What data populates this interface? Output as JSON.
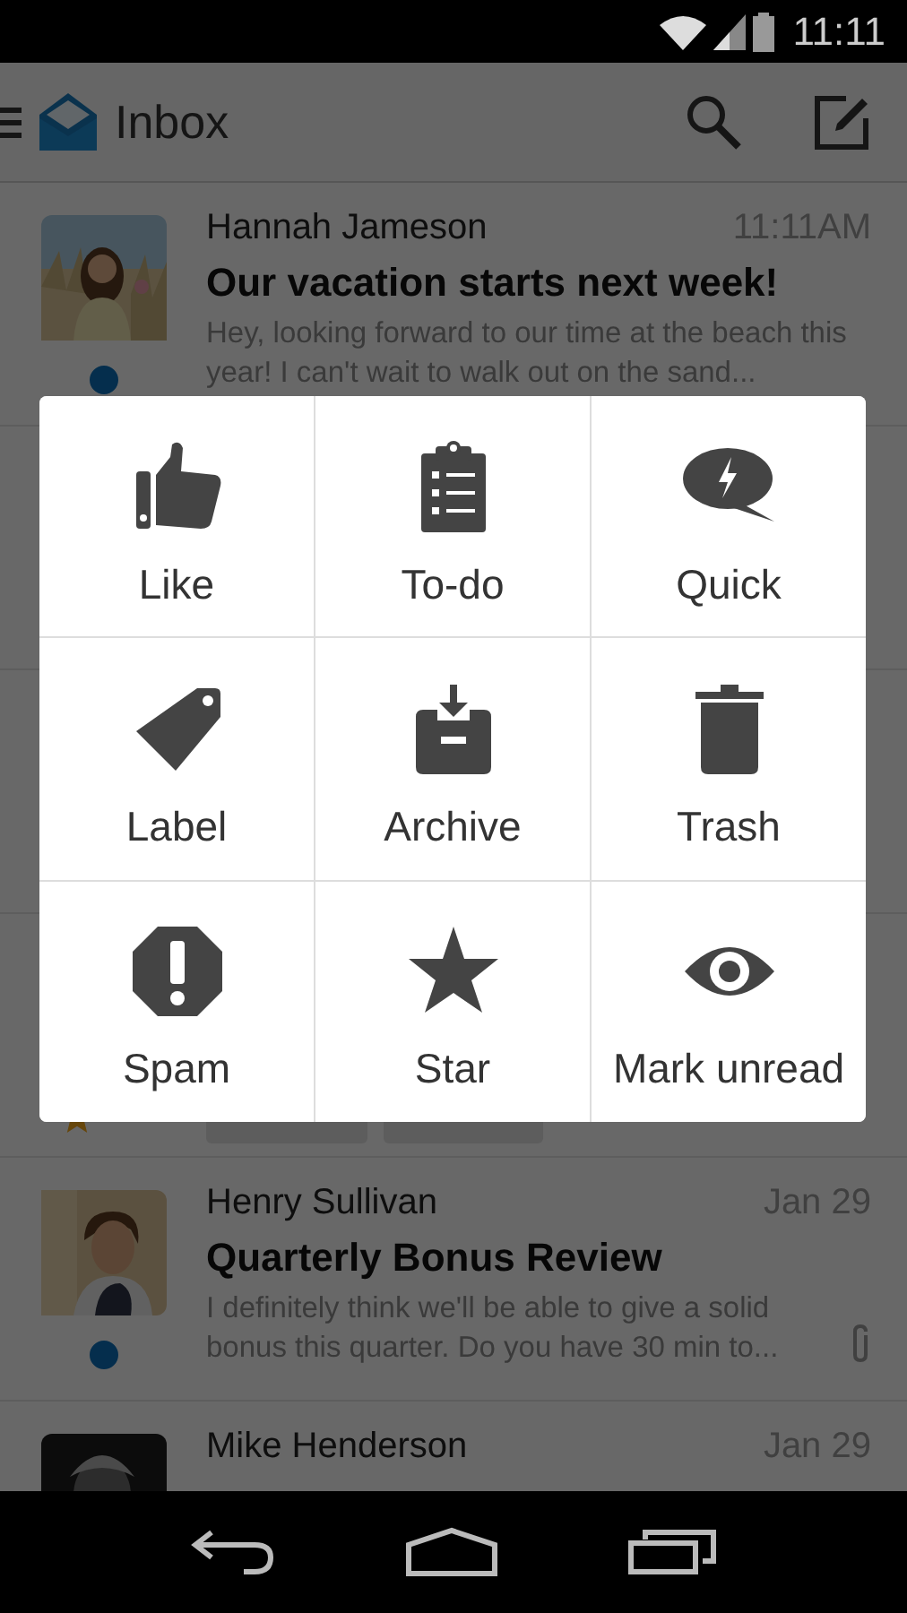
{
  "status_bar": {
    "time": "11:11"
  },
  "app_bar": {
    "title": "Inbox"
  },
  "emails": [
    {
      "kind": "message",
      "sender": "Hannah Jameson",
      "time": "11:11AM",
      "subject": "Our vacation starts next week!",
      "preview": "Hey, looking forward to our time at the beach this year! I can't wait to walk out on the sand...",
      "unread": true,
      "attachment": false
    },
    {
      "kind": "covered"
    },
    {
      "kind": "covered"
    },
    {
      "kind": "covered",
      "starred": true
    },
    {
      "kind": "message",
      "sender": "Henry Sullivan",
      "time": "Jan 29",
      "subject": "Quarterly Bonus Review",
      "preview": "I definitely think we'll be able to give a solid bonus this quarter. Do you have 30 min to...",
      "unread": true,
      "attachment": true
    },
    {
      "kind": "message",
      "sender": "Mike Henderson",
      "time": "Jan 29"
    }
  ],
  "actions": [
    {
      "kind": "like",
      "label": "Like"
    },
    {
      "kind": "todo",
      "label": "To-do"
    },
    {
      "kind": "quick",
      "label": "Quick"
    },
    {
      "kind": "label",
      "label": "Label"
    },
    {
      "kind": "archive",
      "label": "Archive"
    },
    {
      "kind": "trash",
      "label": "Trash"
    },
    {
      "kind": "spam",
      "label": "Spam"
    },
    {
      "kind": "star",
      "label": "Star"
    },
    {
      "kind": "unread",
      "label": "Mark unread"
    }
  ]
}
